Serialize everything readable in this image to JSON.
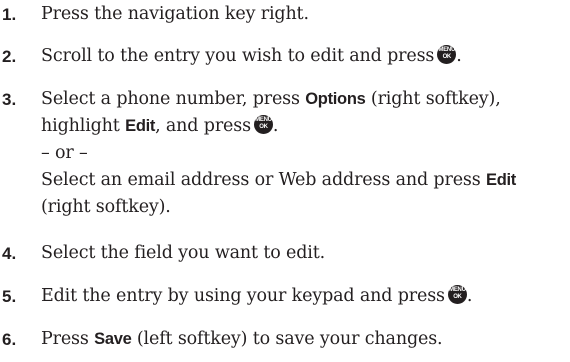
{
  "menu_ok_key": {
    "icon": "menu-ok-key-icon",
    "top_text": "MENU",
    "bottom_text": "OK"
  },
  "steps": [
    {
      "number": "1.",
      "text": "Press the navigation key right."
    },
    {
      "number": "2.",
      "text": "Scroll to the entry you wish to edit and press",
      "end": "."
    },
    {
      "number": "3.",
      "line1_a": "Select a phone number, press ",
      "line1_kw": "Options",
      "line1_b": " (right softkey),",
      "line2_a": "highlight ",
      "line2_kw": "Edit",
      "line2_b": ", and press",
      "line2_end": ".",
      "or_text": "– or –",
      "line4_a": "Select an email address or Web address and press ",
      "line4_kw": "Edit",
      "line5": "(right softkey)."
    },
    {
      "number": "4.",
      "text": "Select the field you want to edit."
    },
    {
      "number": "5.",
      "text": "Edit the entry by using your keypad and press",
      "end": "."
    },
    {
      "number": "6.",
      "text_a": "Press ",
      "kw": "Save",
      "text_b": " (left softkey) to save your changes."
    }
  ]
}
